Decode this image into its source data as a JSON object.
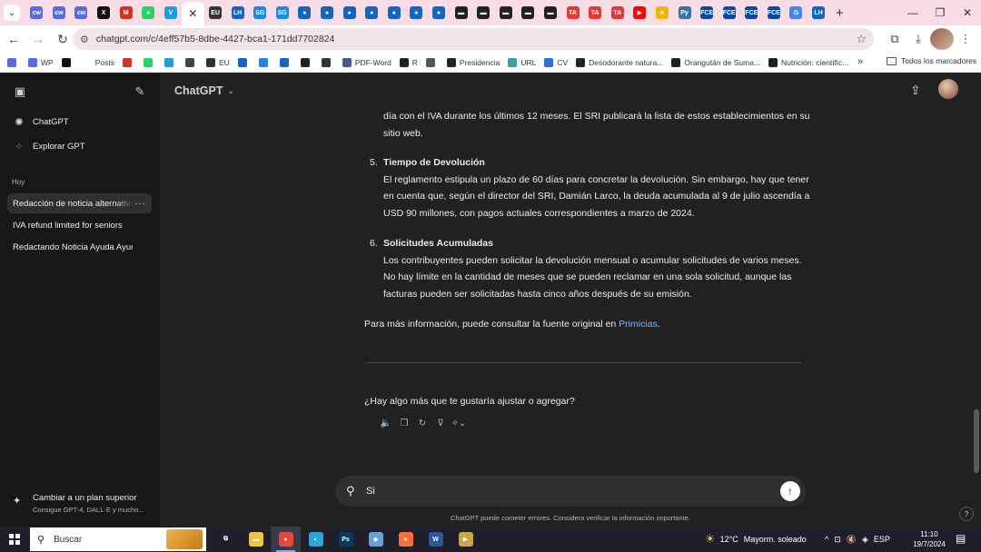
{
  "browser": {
    "tabs": [
      {
        "icon": "cw-icon",
        "label": "cw",
        "color": "#5a6be0"
      },
      {
        "icon": "cw-icon",
        "label": "cw",
        "color": "#5a6be0"
      },
      {
        "icon": "cw-icon",
        "label": "cw",
        "color": "#5a6be0"
      },
      {
        "icon": "x-icon",
        "label": "X",
        "color": "#111111"
      },
      {
        "icon": "gmail-icon",
        "label": "M",
        "color": "#d93025"
      },
      {
        "icon": "whatsapp-icon",
        "label": "●",
        "color": "#25d366"
      },
      {
        "icon": "venmo-icon",
        "label": "V",
        "color": "#1a9fe0"
      },
      {
        "icon": "close-icon",
        "label": "✕",
        "color": "#ffffff",
        "active": true
      },
      {
        "icon": "eu-icon",
        "label": "EU",
        "color": "#333333"
      },
      {
        "icon": "lh-icon",
        "label": "LH",
        "color": "#1565c0"
      },
      {
        "icon": "sg-icon",
        "label": "SG",
        "color": "#1e88e5"
      },
      {
        "icon": "sg-icon",
        "label": "SG",
        "color": "#1e88e5"
      },
      {
        "icon": "shield-icon",
        "label": "●",
        "color": "#1565c0"
      },
      {
        "icon": "shield-icon",
        "label": "●",
        "color": "#1565c0"
      },
      {
        "icon": "shield-icon",
        "label": "●",
        "color": "#1565c0"
      },
      {
        "icon": "shield-icon",
        "label": "●",
        "color": "#1565c0"
      },
      {
        "icon": "shield-icon",
        "label": "●",
        "color": "#1565c0"
      },
      {
        "icon": "shield-icon",
        "label": "●",
        "color": "#1565c0"
      },
      {
        "icon": "shield-icon",
        "label": "●",
        "color": "#1565c0"
      },
      {
        "icon": "dots-icon",
        "label": "▬",
        "color": "#222222"
      },
      {
        "icon": "dots-icon",
        "label": "▬",
        "color": "#222222"
      },
      {
        "icon": "dots-icon",
        "label": "▬",
        "color": "#222222"
      },
      {
        "icon": "dots-icon",
        "label": "▬",
        "color": "#222222"
      },
      {
        "icon": "dots-icon",
        "label": "▬",
        "color": "#222222"
      },
      {
        "icon": "ta-icon",
        "label": "TA",
        "color": "#e53935"
      },
      {
        "icon": "ta-icon",
        "label": "TA",
        "color": "#e53935"
      },
      {
        "icon": "ta-icon",
        "label": "TA",
        "color": "#e53935"
      },
      {
        "icon": "youtube-icon",
        "label": "▶",
        "color": "#ff0000"
      },
      {
        "icon": "star-icon",
        "label": "★",
        "color": "#f5b400"
      },
      {
        "icon": "python-icon",
        "label": "Py",
        "color": "#3572a5"
      },
      {
        "icon": "fce-icon",
        "label": "FCE",
        "color": "#0d47a1"
      },
      {
        "icon": "fce-icon",
        "label": "FCE",
        "color": "#0d47a1"
      },
      {
        "icon": "fce-icon",
        "label": "FCE",
        "color": "#0d47a1"
      },
      {
        "icon": "fce-icon",
        "label": "FCE",
        "color": "#0d47a1"
      },
      {
        "icon": "google-icon",
        "label": "G",
        "color": "#4285f4"
      },
      {
        "icon": "lh-icon",
        "label": "LH",
        "color": "#1565c0"
      }
    ],
    "new_tab": "+",
    "window_controls": {
      "minimize": "—",
      "maximize": "❐",
      "close": "✕"
    },
    "url": "chatgpt.com/c/4eff57b5-8dbe-4427-bca1-171dd7702824",
    "bookmarks": [
      {
        "icon": "cw-icon",
        "label": "",
        "color": "#5a6be0"
      },
      {
        "icon": "cw-icon",
        "label": "WP",
        "color": "#5a6be0"
      },
      {
        "icon": "x-icon",
        "label": "",
        "color": "#111111"
      },
      {
        "icon": "blank-icon",
        "label": "Posts",
        "color": "#ffffff"
      },
      {
        "icon": "gmail-icon",
        "label": "",
        "color": "#d93025"
      },
      {
        "icon": "whatsapp-icon",
        "label": "",
        "color": "#25d366"
      },
      {
        "icon": "venmo-icon",
        "label": "",
        "color": "#1a9fe0"
      },
      {
        "icon": "openai-icon",
        "label": "",
        "color": "#444444"
      },
      {
        "icon": "eu-icon",
        "label": "EU",
        "color": "#333333"
      },
      {
        "icon": "lh-icon",
        "label": "",
        "color": "#1565c0"
      },
      {
        "icon": "sg-icon",
        "label": "",
        "color": "#1e88e5"
      },
      {
        "icon": "shield-icon",
        "label": "",
        "color": "#1565c0"
      },
      {
        "icon": "dots-icon",
        "label": "",
        "color": "#222222"
      },
      {
        "icon": "e-icon",
        "label": "",
        "color": "#333333"
      },
      {
        "icon": "pdf-icon",
        "label": "PDF-Word",
        "color": "#4a5a8a"
      },
      {
        "icon": "r-icon",
        "label": "R",
        "color": "#222222"
      },
      {
        "icon": "globe-icon",
        "label": "",
        "color": "#555555"
      },
      {
        "icon": "dots-icon",
        "label": "Presidencia",
        "color": "#222222"
      },
      {
        "icon": "url-icon",
        "label": "URL",
        "color": "#3aa0a0"
      },
      {
        "icon": "cv-icon",
        "label": "CV",
        "color": "#2c6fd6"
      },
      {
        "icon": "dots-icon",
        "label": "Desodorante natura...",
        "color": "#222222"
      },
      {
        "icon": "dots-icon",
        "label": "Orangután de Suma...",
        "color": "#222222"
      },
      {
        "icon": "dots-icon",
        "label": "Nutrición: científic...",
        "color": "#222222"
      }
    ],
    "bookmarks_more": "»",
    "all_bookmarks": "Todos los marcadores"
  },
  "sidebar": {
    "nav": [
      {
        "label": "ChatGPT",
        "icon": "openai-icon"
      },
      {
        "label": "Explorar GPT",
        "icon": "grid-icon"
      }
    ],
    "section_label": "Hoy",
    "chats": [
      {
        "label": "Redacción de noticia alternativa",
        "active": true
      },
      {
        "label": "IVA refund limited for seniors",
        "active": false
      },
      {
        "label": "Redactando Noticia Ayuda Ayuda",
        "active": false
      }
    ],
    "chat_menu": "···",
    "upgrade": {
      "title": "Cambiar a un plan superior",
      "subtitle": "Consigue GPT-4, DALL·E y mucho..."
    }
  },
  "header": {
    "model": "ChatGPT",
    "model_chevron": "⌄"
  },
  "message": {
    "top_paragraph": "día con el IVA durante los últimos 12 meses. El SRI publicará la lista de estos establecimientos en su sitio web.",
    "items": [
      {
        "number": "5.",
        "title": "Tiempo de Devolución",
        "text": "El reglamento estipula un plazo de 60 días para concretar la devolución. Sin embargo, hay que tener en cuenta que, según el director del SRI, Damián Larco, la deuda acumulada al 9 de julio ascendía a USD 90 millones, con pagos actuales correspondientes a marzo de 2024."
      },
      {
        "number": "6.",
        "title": "Solicitudes Acumuladas",
        "text": "Los contribuyentes pueden solicitar la devolución mensual o acumular solicitudes de varios meses. No hay límite en la cantidad de meses que se pueden reclamar en una sola solicitud, aunque las facturas pueden ser solicitadas hasta cinco años después de su emisión."
      }
    ],
    "source_prefix": "Para más información, puede consultar la fuente original en ",
    "source_link": "Primicias",
    "source_suffix": ".",
    "question": "¿Hay algo más que te gustaría ajustar o agregar?"
  },
  "composer": {
    "value": "Si",
    "disclaimer": "ChatGPT puede cometer errores. Considera verificar la información importante."
  },
  "help": "?",
  "taskbar": {
    "search_placeholder": "Buscar",
    "apps": [
      {
        "icon": "task-view-icon",
        "label": "⧉",
        "color": "#1f1f2b"
      },
      {
        "icon": "file-explorer-icon",
        "label": "▬",
        "color": "#f3c241"
      },
      {
        "icon": "chrome-icon",
        "label": "●",
        "color": "#e8453c",
        "active": true
      },
      {
        "icon": "edge-icon",
        "label": "◐",
        "color": "#2ea6d8"
      },
      {
        "icon": "photoshop-icon",
        "label": "Ps",
        "color": "#0b3b5c"
      },
      {
        "icon": "app-icon",
        "label": "◆",
        "color": "#6a9fd8"
      },
      {
        "icon": "firefox-icon",
        "label": "●",
        "color": "#ff7139"
      },
      {
        "icon": "word-icon",
        "label": "W",
        "color": "#2b5797"
      },
      {
        "icon": "media-icon",
        "label": "▶",
        "color": "#c9a640"
      }
    ],
    "weather_temp": "12°C",
    "weather_text": "Mayorm. soleado",
    "tray": [
      "^",
      "⊡",
      "🔇",
      "◈"
    ],
    "language": "ESP",
    "time": "11:10",
    "date": "19/7/2024"
  }
}
